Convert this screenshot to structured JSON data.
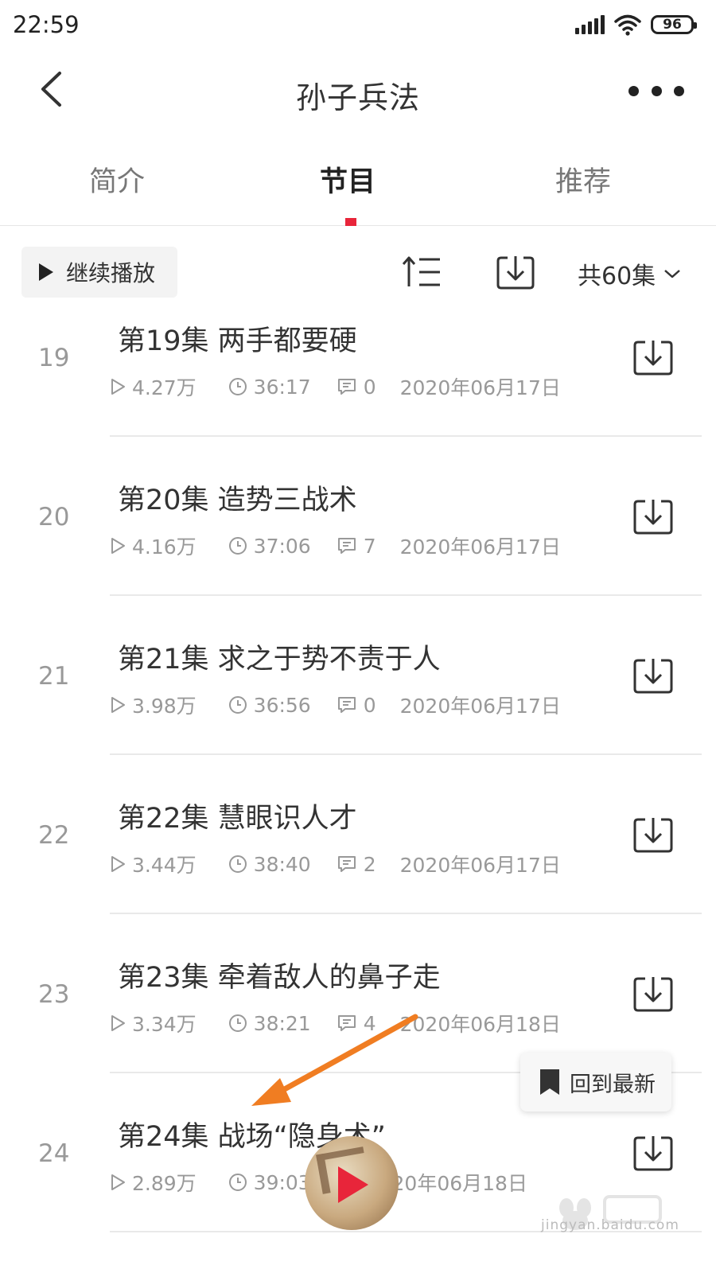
{
  "status_bar": {
    "time": "22:59",
    "battery": "96"
  },
  "header": {
    "title": "孙子兵法"
  },
  "tabs": [
    {
      "label": "简介",
      "active": false
    },
    {
      "label": "节目",
      "active": true
    },
    {
      "label": "推荐",
      "active": false
    }
  ],
  "toolbar": {
    "continue_label": "继续播放",
    "episode_count": "共60集"
  },
  "episodes": [
    {
      "number": "19",
      "title": "第19集 两手都要硬",
      "plays": "4.27万",
      "duration": "36:17",
      "comments": "0",
      "date": "2020年06月17日"
    },
    {
      "number": "20",
      "title": "第20集 造势三战术",
      "plays": "4.16万",
      "duration": "37:06",
      "comments": "7",
      "date": "2020年06月17日"
    },
    {
      "number": "21",
      "title": "第21集 求之于势不责于人",
      "plays": "3.98万",
      "duration": "36:56",
      "comments": "0",
      "date": "2020年06月17日"
    },
    {
      "number": "22",
      "title": "第22集 慧眼识人才",
      "plays": "3.44万",
      "duration": "38:40",
      "comments": "2",
      "date": "2020年06月17日"
    },
    {
      "number": "23",
      "title": "第23集 牵着敌人的鼻子走",
      "plays": "3.34万",
      "duration": "38:21",
      "comments": "4",
      "date": "2020年06月18日"
    },
    {
      "number": "24",
      "title": "第24集 战场“隐身术”",
      "plays": "2.89万",
      "duration": "39:03",
      "comments": "",
      "date": "2020年06月18日"
    }
  ],
  "floating": {
    "back_to_latest": "回到最新"
  },
  "watermark": {
    "text": "jingyan.baidu.com"
  },
  "colors": {
    "accent": "#e8253a",
    "arrow": "#f07d22"
  },
  "icons": [
    "back-icon",
    "more-icon",
    "play-icon",
    "sort-icon",
    "download-icon",
    "chevron-down-icon",
    "play-count-icon",
    "clock-icon",
    "comment-icon",
    "bookmark-icon"
  ]
}
